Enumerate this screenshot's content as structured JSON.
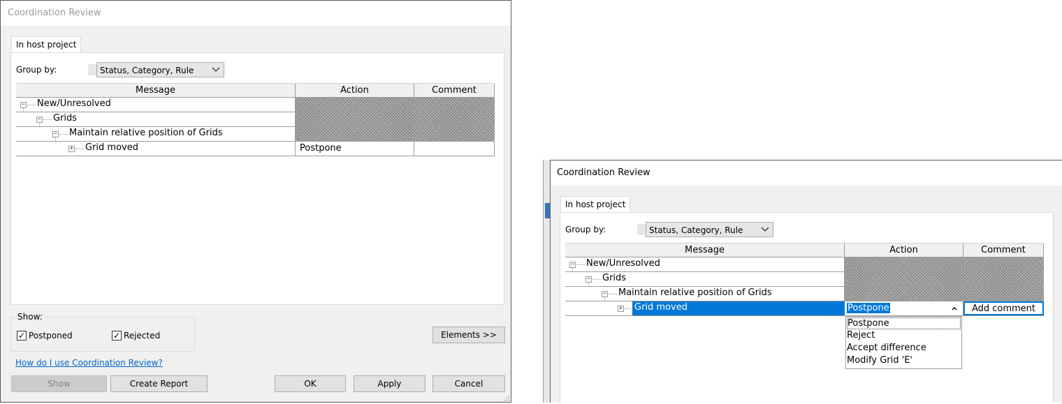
{
  "left_dialog": {
    "title": "Coordination Review",
    "tab": "In host project",
    "group_by_label": "Group by:",
    "group_by_value": "Status, Category, Rule",
    "columns": [
      "Message",
      "Action",
      "Comment"
    ],
    "rows": [
      {
        "message": "New/Unresolved",
        "expander": "−",
        "action": "",
        "comment": ""
      },
      {
        "message": "Grids",
        "expander": "−",
        "action": "",
        "comment": ""
      },
      {
        "message": "Maintain relative position of Grids",
        "expander": "−",
        "action": "",
        "comment": ""
      },
      {
        "message": "Grid moved",
        "expander": "+",
        "action": "Postpone",
        "comment": ""
      }
    ],
    "show_label": "Show:",
    "postponed_label": "Postponed",
    "postponed_checked": true,
    "rejected_label": "Rejected",
    "rejected_checked": true,
    "elements_button": "Elements >>",
    "help_link": "How do I use Coordination Review?",
    "show_button": "Show",
    "create_report_button": "Create Report",
    "ok_button": "OK",
    "apply_button": "Apply",
    "cancel_button": "Cancel"
  },
  "right_dialog": {
    "title": "Coordination Review",
    "tab": "In host project",
    "group_by_label": "Group by:",
    "group_by_value": "Status, Category, Rule",
    "columns": [
      "Message",
      "Action",
      "Comment"
    ],
    "rows": [
      {
        "message": "New/Unresolved",
        "expander": "−"
      },
      {
        "message": "Grids",
        "expander": "−"
      },
      {
        "message": "Maintain relative position of Grids",
        "expander": "−"
      },
      {
        "message": "Grid moved",
        "expander": "+",
        "action": "Postpone",
        "comment": "Add comment"
      }
    ],
    "action_options": [
      "Postpone",
      "Reject",
      "Accept difference",
      "Modify Grid 'E'"
    ]
  },
  "colors": {
    "selection": "#0078d7",
    "link": "#0066cc",
    "dialog_bg": "#f0f0f0"
  }
}
